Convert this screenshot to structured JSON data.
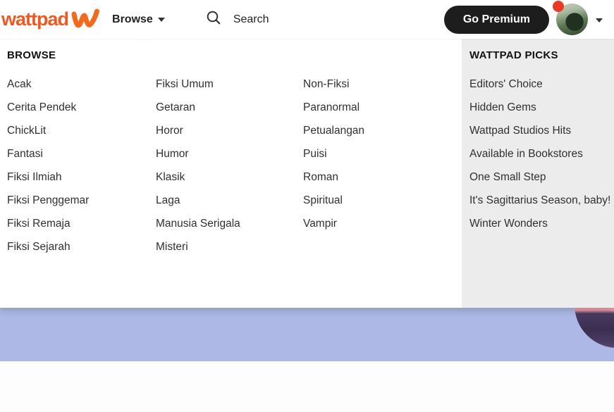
{
  "navbar": {
    "logo_text": "wattpad",
    "browse_label": "Browse",
    "search_placeholder": "Search",
    "premium_button_label": "Go Premium"
  },
  "dropdown": {
    "browse_heading": "BROWSE",
    "columns": [
      [
        "Acak",
        "Cerita Pendek",
        "ChickLit",
        "Fantasi",
        "Fiksi Ilmiah",
        "Fiksi Penggemar",
        "Fiksi Remaja",
        "Fiksi Sejarah"
      ],
      [
        "Fiksi Umum",
        "Getaran",
        "Horor",
        "Humor",
        "Klasik",
        "Laga",
        "Manusia Serigala",
        "Misteri"
      ],
      [
        "Non-Fiksi",
        "Paranormal",
        "Petualangan",
        "Puisi",
        "Roman",
        "Spiritual",
        "Vampir"
      ]
    ],
    "picks_heading": "WATTPAD PICKS",
    "picks": [
      "Editors' Choice",
      "Hidden Gems",
      "Wattpad Studios Hits",
      "Available in Bookstores",
      "One Small Step",
      "It's Sagittarius Season, baby!",
      "Winter Wonders"
    ]
  },
  "icons": {
    "logo_mark": "wattpad-w",
    "browse_caret": "chevron-down",
    "search": "magnifier",
    "notification": "red-dot",
    "profile_caret": "chevron-down",
    "carousel_prev": "arrow-left",
    "carousel_next": "arrow-right",
    "carousel_dot": "dot"
  },
  "colors": {
    "brand_orange": "#ee5823",
    "premium_black": "#1d1d1d",
    "picks_panel_bg": "#ececec",
    "hero_lavender": "#adb8e6",
    "notification_red": "#ea3a26",
    "text_dark": "#222222"
  }
}
